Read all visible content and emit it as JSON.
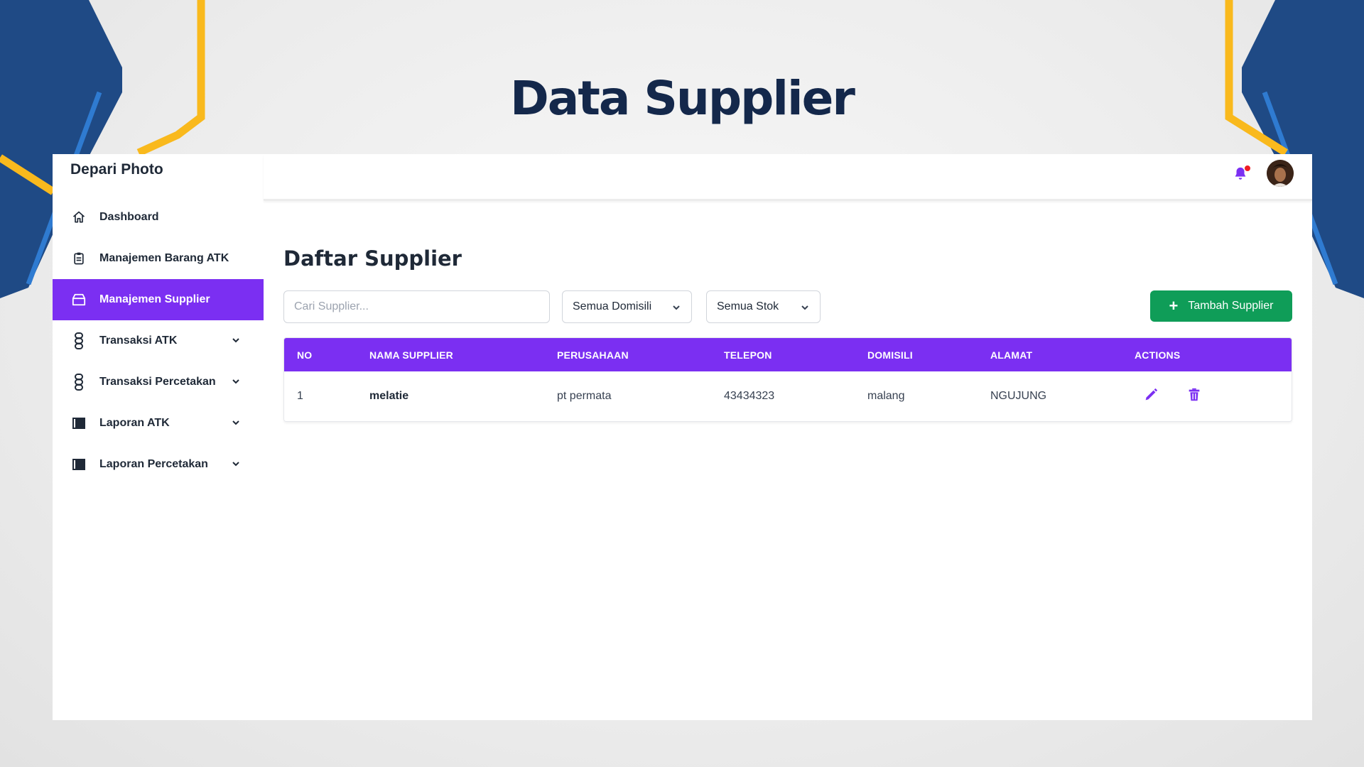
{
  "slide": {
    "title": "Data Supplier"
  },
  "app": {
    "brand": "Depari Photo"
  },
  "header": {
    "bell_icon": "bell-icon",
    "notification_dot_color": "#ef1c24"
  },
  "sidebar": {
    "active_color": "#7b2ff2",
    "items": [
      {
        "label": "Dashboard",
        "icon": "home-icon"
      },
      {
        "label": "Manajemen Barang ATK",
        "icon": "clipboard-icon"
      },
      {
        "label": "Manajemen Supplier",
        "icon": "box-icon",
        "active": true
      },
      {
        "label": "Transaksi ATK",
        "icon": "chain-icon",
        "expandable": true
      },
      {
        "label": "Transaksi Percetakan",
        "icon": "chain-icon",
        "expandable": true
      },
      {
        "label": "Laporan ATK",
        "icon": "book-icon",
        "expandable": true
      },
      {
        "label": "Laporan Percetakan",
        "icon": "book-icon",
        "expandable": true
      }
    ]
  },
  "main": {
    "title": "Daftar Supplier",
    "search": {
      "placeholder": "Cari Supplier...",
      "value": ""
    },
    "filters": {
      "domisili": "Semua Domisili",
      "stok": "Semua Stok"
    },
    "add_button": {
      "label": "Tambah Supplier",
      "color": "#0f9d58"
    },
    "table": {
      "header_color": "#7b2ff2",
      "columns": [
        "NO",
        "NAMA SUPPLIER",
        "PERUSAHAAN",
        "TELEPON",
        "DOMISILI",
        "ALAMAT",
        "ACTIONS"
      ],
      "rows": [
        {
          "no": "1",
          "nama": "melatie",
          "perusahaan": "pt permata",
          "telepon": "43434323",
          "domisili": "malang",
          "alamat": "NGUJUNG",
          "actions": [
            "edit-icon",
            "trash-icon"
          ]
        }
      ]
    }
  }
}
